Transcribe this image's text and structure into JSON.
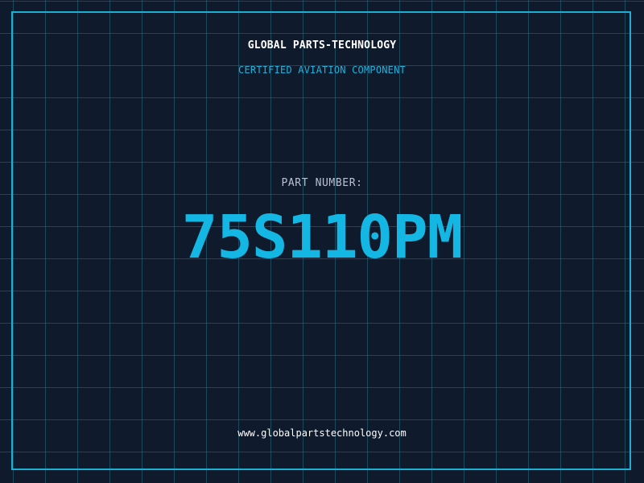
{
  "header": {
    "company": "GLOBAL PARTS-TECHNOLOGY",
    "subtitle": "CERTIFIED AVIATION COMPONENT"
  },
  "part": {
    "label": "PART NUMBER:",
    "number": "75S110PM"
  },
  "footer": {
    "website": "www.globalpartstechnology.com"
  },
  "colors": {
    "background": "#101a2d",
    "grid": "#266e87",
    "accent": "#14b6e3",
    "frame": "#1faed3",
    "text": "#ffffff"
  }
}
